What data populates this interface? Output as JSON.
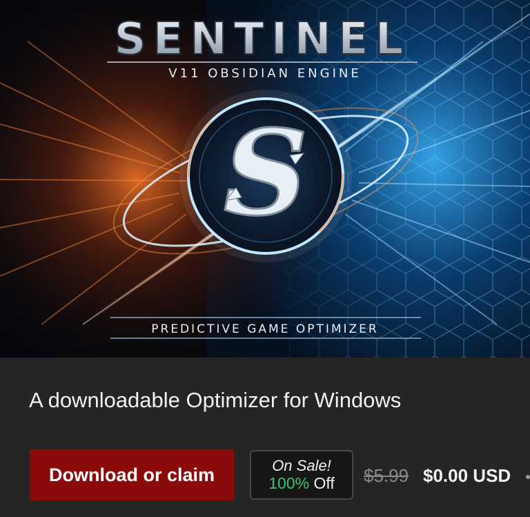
{
  "banner": {
    "title": "SENTINEL",
    "subtitle": "V11 OBSIDIAN ENGINE",
    "tagline": "PREDICTIVE GAME OPTIMIZER",
    "logo_letter": "S",
    "colors": {
      "warm": "#ff6a1a",
      "cool": "#2ea8ff",
      "background": "#05070c"
    }
  },
  "product": {
    "description": "A downloadable Optimizer for Windows"
  },
  "purchase": {
    "download_label": "Download or claim",
    "sale_label": "On Sale!",
    "discount_percent": "100%",
    "discount_suffix": " Off",
    "original_price": "$5.99",
    "sale_price": "$0.00 USD"
  },
  "colors": {
    "page_background": "#252525",
    "download_button": "#8b0b0b",
    "discount_green": "#3fbf7a"
  }
}
